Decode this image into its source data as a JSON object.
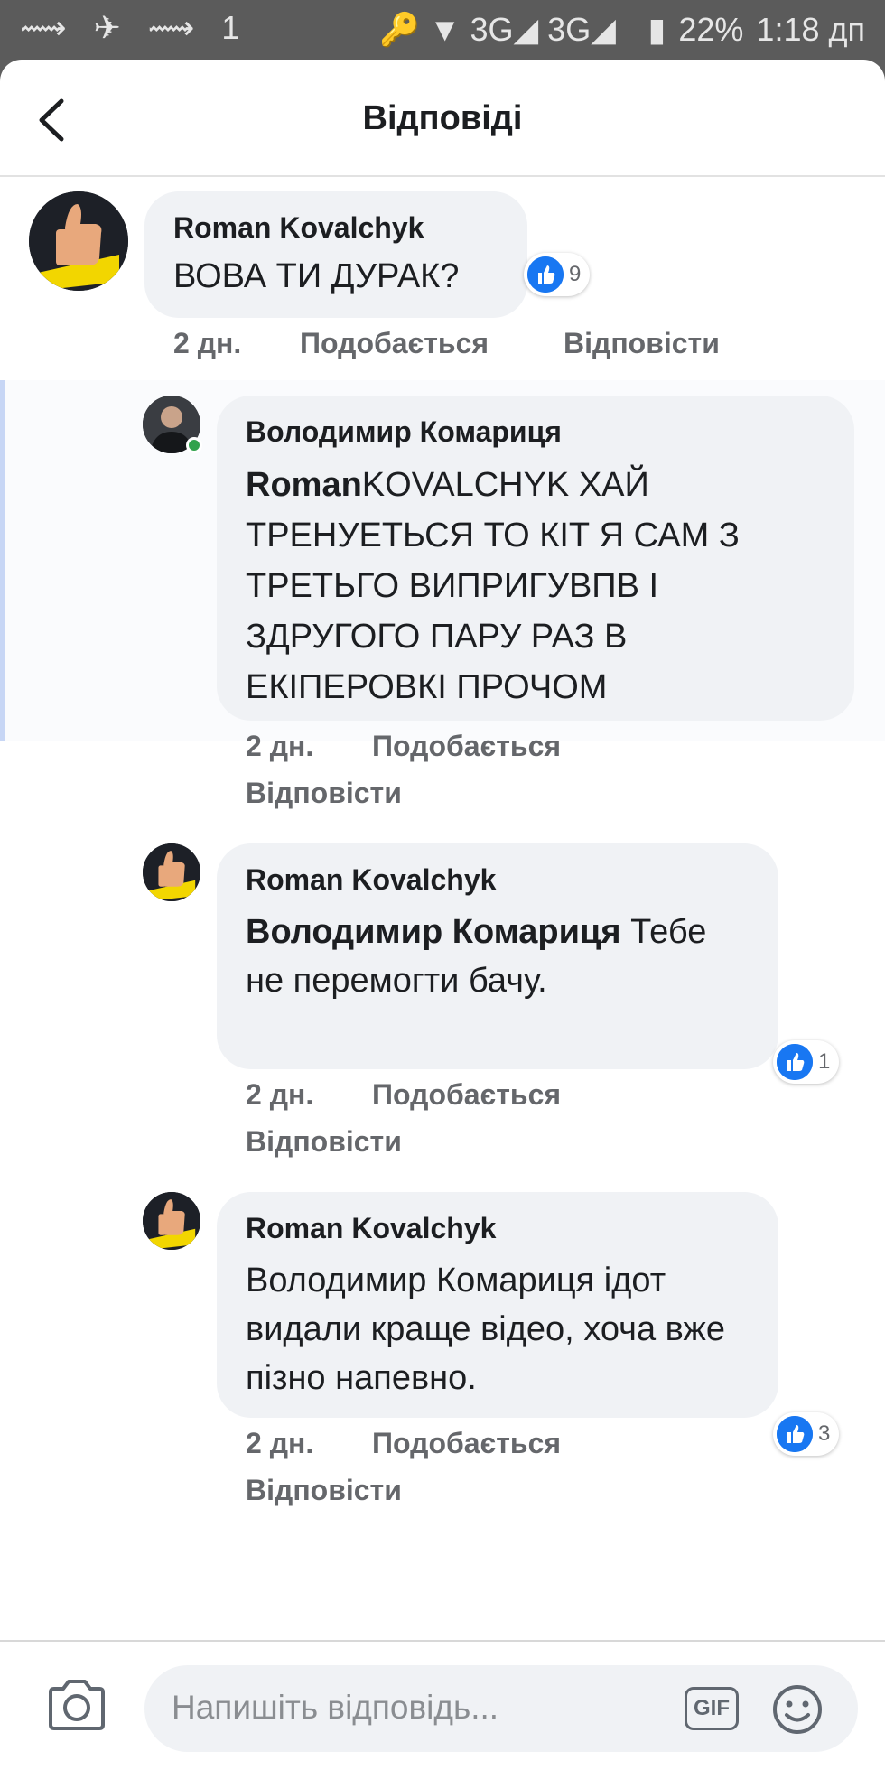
{
  "status_bar": {
    "left_icons": "⟿ ✈ ⟿ 1",
    "network": "🔑 ▼ 3G◢ 3G◢",
    "battery": "22%",
    "time": "1:18 дп"
  },
  "header": {
    "title": "Відповіді"
  },
  "comments": [
    {
      "author": "Roman  Kovalchyk",
      "mention": "",
      "text": "ВОВА ТИ ДУРАК?",
      "reactions": "9",
      "time": "2 дн.",
      "like": "Подобається",
      "reply": "Відповісти"
    },
    {
      "author": "Володимир Комариця",
      "mention": "Roman",
      "text": "KOVALCHYK ХАЙ ТРЕНУЕТЬСЯ ТО КІТ Я САМ З ТРЕТЬГО ВИПРИГУВПВ І ЗДРУГОГО ПАРУ РАЗ В ЕКІПЕРОВКІ ПРОЧОМ",
      "time": "2 дн.",
      "like": "Подобається",
      "reply": "Відповісти"
    },
    {
      "author": "Roman  Kovalchyk",
      "mention": "Володимир Комариця",
      "text": " Тебе не перемогти бачу.",
      "reactions": "1",
      "time": "2 дн.",
      "like": "Подобається",
      "reply": "Відповісти"
    },
    {
      "author": "Roman  Kovalchyk",
      "mention": "",
      "text": "Володимир Комариця ідот видали  краще відео,  хоча вже пізно напевно.",
      "reactions": "3",
      "time": "2 дн.",
      "like": "Подобається",
      "reply": "Відповісти"
    }
  ],
  "composer": {
    "placeholder": "Напишіть відповідь...",
    "gif_label": "GIF",
    "icons": [
      "camera-icon",
      "gif-icon",
      "smile-icon"
    ]
  },
  "colors": {
    "accent": "#1877f2",
    "bubble": "#f0f2f5",
    "meta": "#65676b",
    "online": "#31a24c"
  }
}
